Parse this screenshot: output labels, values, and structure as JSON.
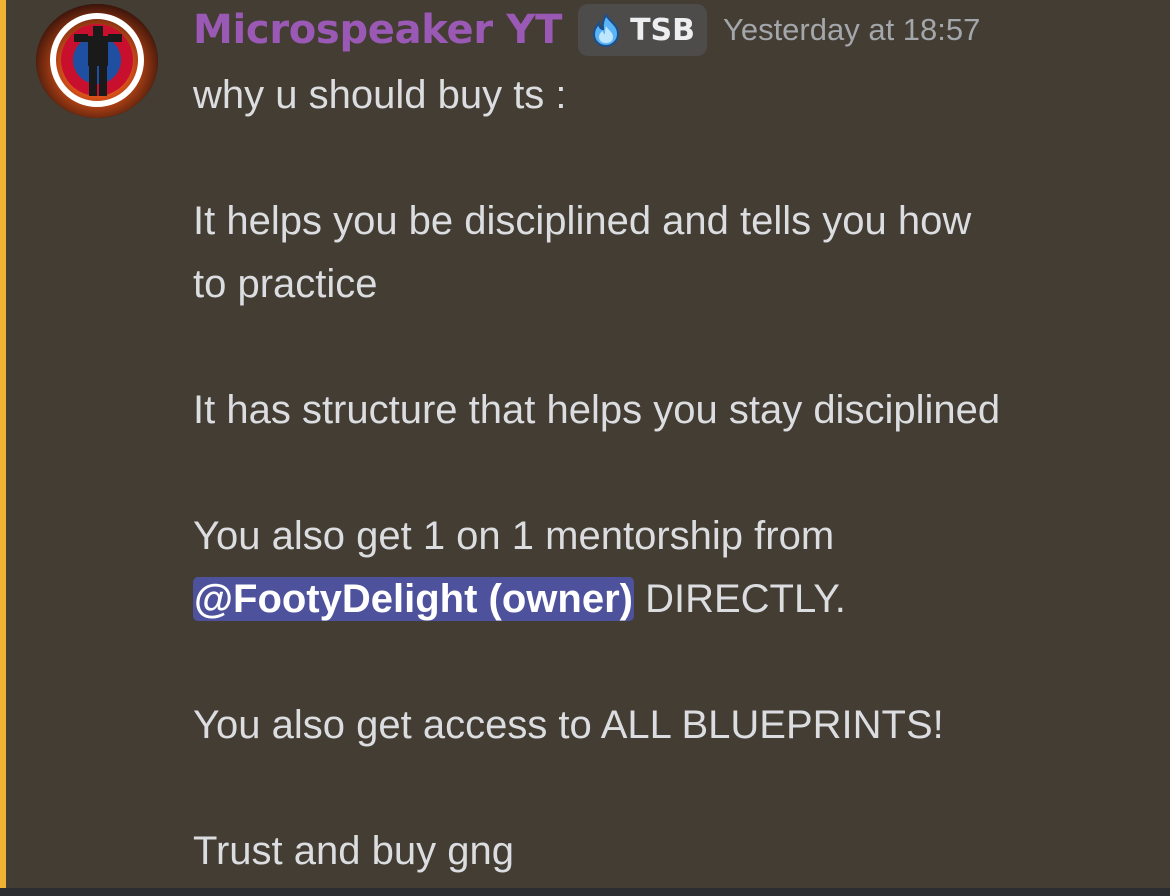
{
  "message": {
    "author": {
      "name": "Microspeaker YT",
      "tag": "TSB",
      "tag_icon": "blue-flame-icon",
      "avatar": "avatar"
    },
    "timestamp": "Yesterday at 18:57",
    "lines": {
      "l1": "why u should buy ts :",
      "l3": "It helps you be disciplined and tells you how",
      "l4": "to practice",
      "l6": "It has structure that helps you stay disciplined",
      "l8": "You also get 1 on 1 mentorship from",
      "l9_mention": "@FootyDelight (owner)",
      "l9_rest": " DIRECTLY.",
      "l11": "You also get access to ALL BLUEPRINTS!",
      "l13": "Trust and buy gng"
    }
  },
  "colors": {
    "background": "#433d33",
    "accent_bar": "#f0b232",
    "username": "#9b59b6",
    "mention_bg": "#5865f2",
    "text": "#dcdde0",
    "timestamp": "#a3a6aa"
  }
}
